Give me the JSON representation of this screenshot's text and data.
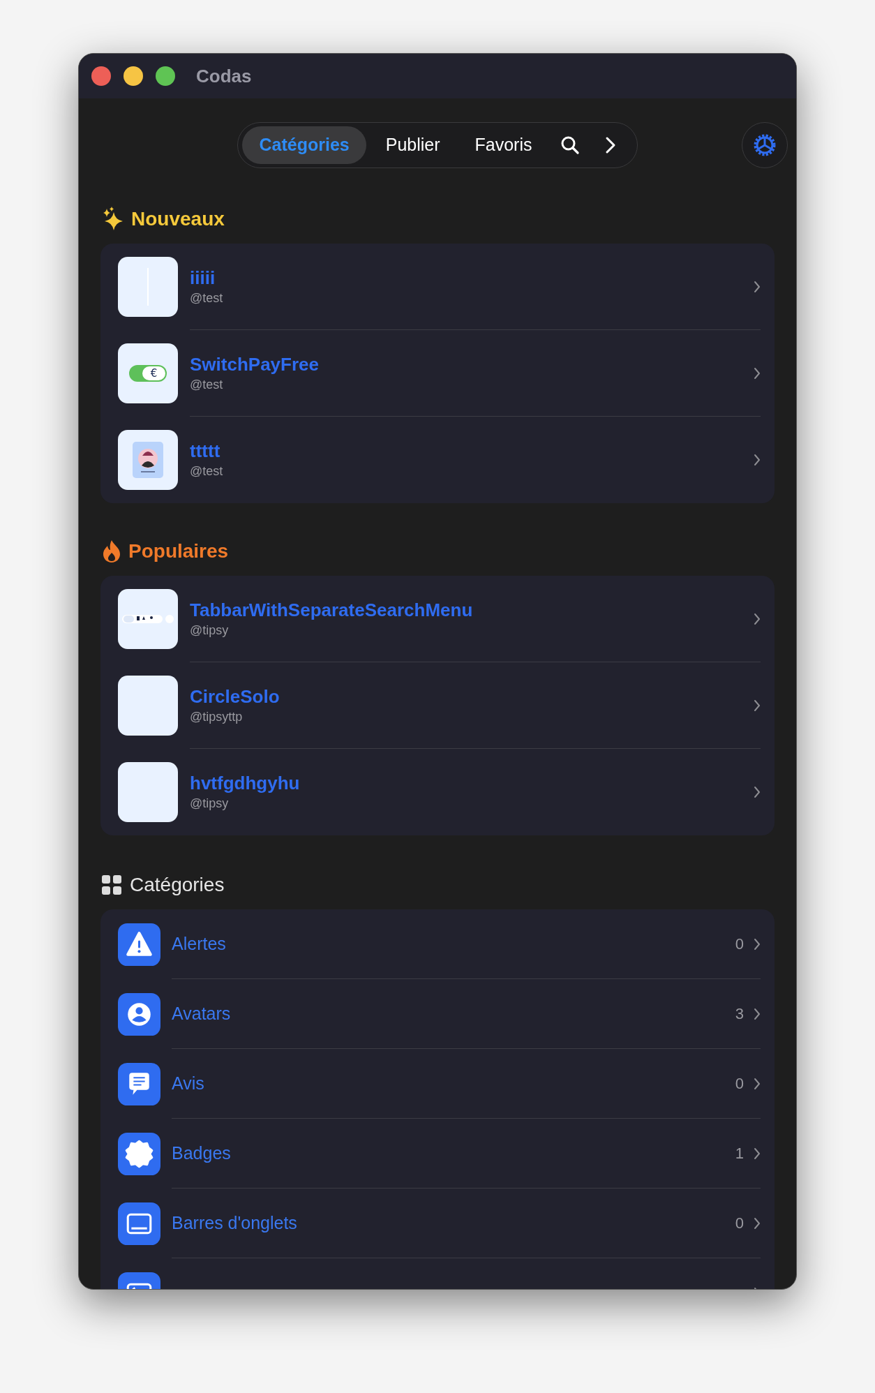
{
  "window": {
    "title": "Codas"
  },
  "tabs": [
    {
      "label": "Catégories",
      "selected": true
    },
    {
      "label": "Publier",
      "selected": false
    },
    {
      "label": "Favoris",
      "selected": false
    }
  ],
  "sections": [
    {
      "kind": "new",
      "title": "Nouveaux",
      "items": [
        {
          "name": "iiiii",
          "author": "@test",
          "kind": "line"
        },
        {
          "name": "SwitchPayFree",
          "author": "@test",
          "kind": "toggle",
          "symbol": "€",
          "on": true
        },
        {
          "name": "ttttt",
          "author": "@test",
          "kind": "avatar"
        }
      ]
    },
    {
      "kind": "popular",
      "title": "Populaires",
      "items": [
        {
          "name": "TabbarWithSeparateSearchMenu",
          "author": "@tipsy",
          "kind": "tabbar"
        },
        {
          "name": "CircleSolo",
          "author": "@tipsyttp",
          "kind": "blank"
        },
        {
          "name": "hvtfgdhgyhu",
          "author": "@tipsy",
          "kind": "blank"
        }
      ]
    }
  ],
  "categories": {
    "title": "Catégories",
    "items": [
      {
        "label": "Alertes",
        "count": "0",
        "kind": "warning"
      },
      {
        "label": "Avatars",
        "count": "3",
        "kind": "person"
      },
      {
        "label": "Avis",
        "count": "0",
        "kind": "message"
      },
      {
        "label": "Badges",
        "count": "1",
        "kind": "badge"
      },
      {
        "label": "Barres d'onglets",
        "count": "0",
        "kind": "tabbar"
      },
      {
        "kind": "navbar"
      }
    ]
  }
}
